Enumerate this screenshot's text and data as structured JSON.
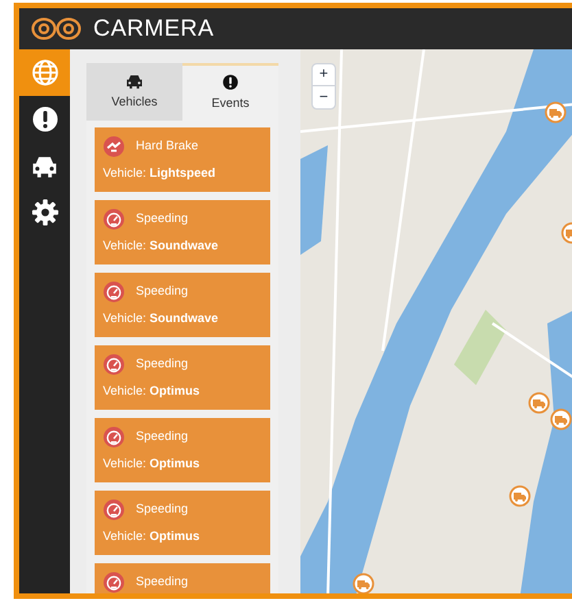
{
  "header": {
    "title": "CARMERA"
  },
  "nav": [
    {
      "kind": "globe",
      "selected": true
    },
    {
      "kind": "alert",
      "selected": false
    },
    {
      "kind": "car",
      "selected": false
    },
    {
      "kind": "gear",
      "selected": false
    }
  ],
  "tabs": [
    {
      "kind": "car",
      "label": "Vehicles",
      "selected": false
    },
    {
      "kind": "alert",
      "label": "Events",
      "selected": true
    }
  ],
  "events": [
    {
      "kind": "brake",
      "type": "Hard Brake",
      "vehicle_label": "Vehicle:",
      "vehicle": "Lightspeed"
    },
    {
      "kind": "speed",
      "type": "Speeding",
      "vehicle_label": "Vehicle:",
      "vehicle": "Soundwave"
    },
    {
      "kind": "speed",
      "type": "Speeding",
      "vehicle_label": "Vehicle:",
      "vehicle": "Soundwave"
    },
    {
      "kind": "speed",
      "type": "Speeding",
      "vehicle_label": "Vehicle:",
      "vehicle": "Optimus"
    },
    {
      "kind": "speed",
      "type": "Speeding",
      "vehicle_label": "Vehicle:",
      "vehicle": "Optimus"
    },
    {
      "kind": "speed",
      "type": "Speeding",
      "vehicle_label": "Vehicle:",
      "vehicle": "Optimus"
    },
    {
      "kind": "speed",
      "type": "Speeding"
    }
  ],
  "map": {
    "zoom_in": "+",
    "zoom_out": "−"
  }
}
